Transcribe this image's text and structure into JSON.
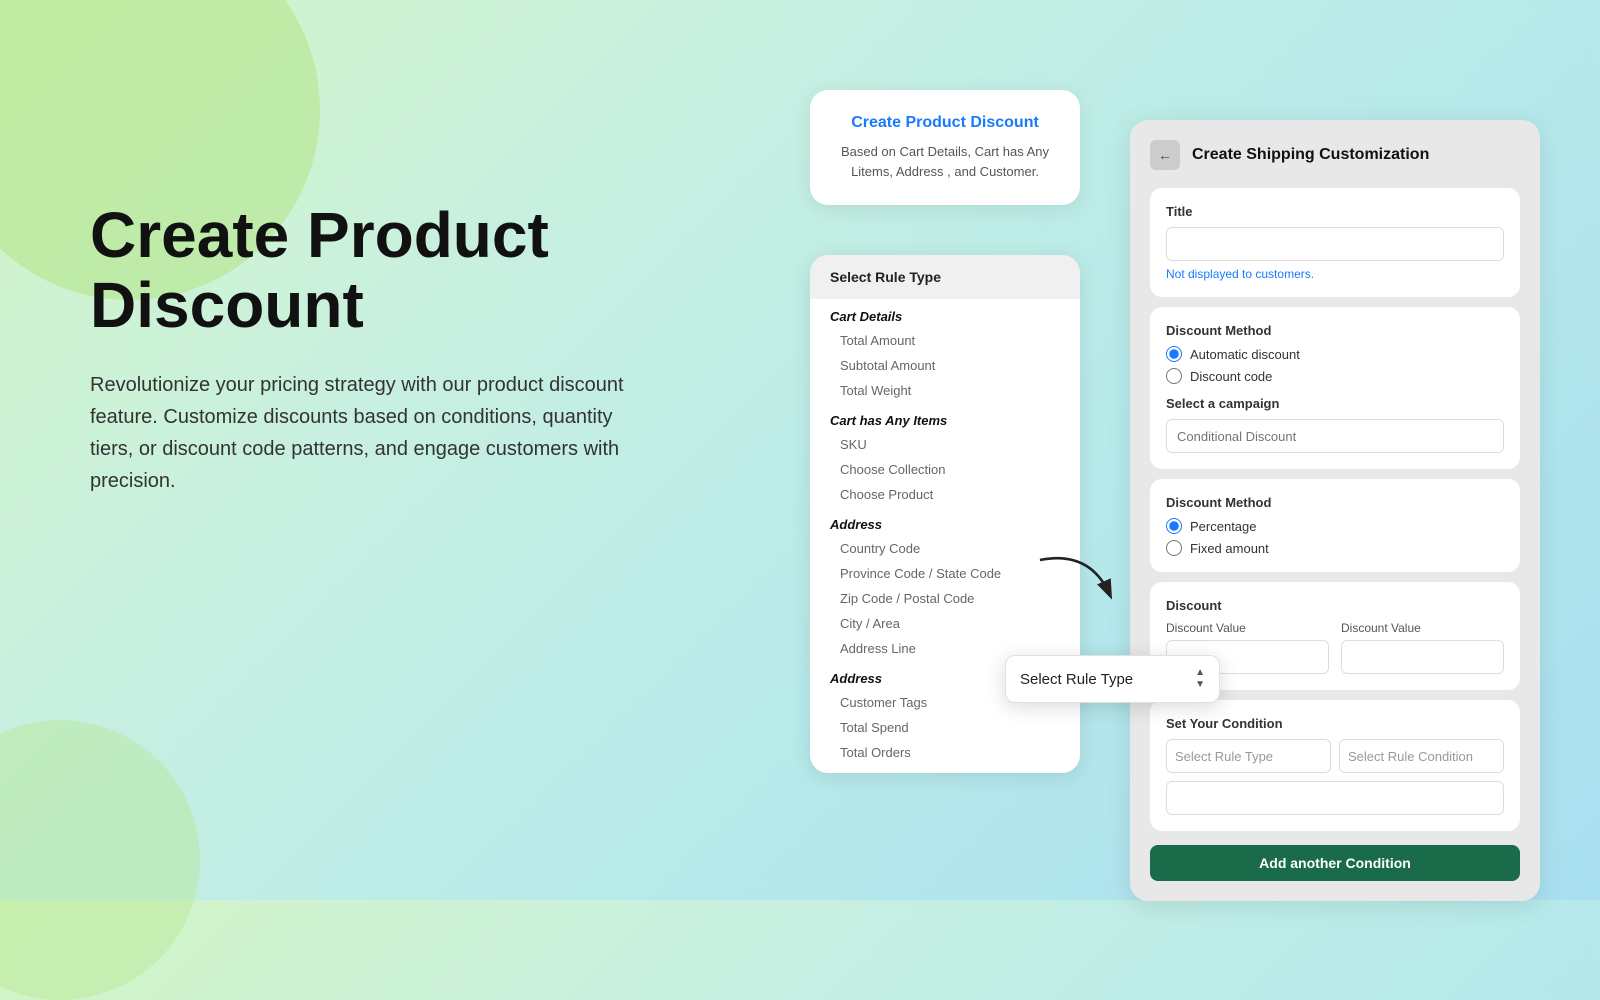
{
  "background": {
    "gradient": "linear-gradient(135deg, #d4f5c4, #b8eaea, #a8dff0)"
  },
  "left": {
    "title": "Create Product Discount",
    "description": "Revolutionize your pricing strategy with our product discount feature. Customize discounts based on conditions, quantity tiers, or discount code patterns, and engage customers with precision."
  },
  "card_info": {
    "title": "Create Product Discount",
    "description": "Based on Cart Details, Cart has Any Litems, Address , and Customer."
  },
  "card_rule": {
    "header": "Select Rule Type",
    "sections": [
      {
        "title": "Cart Details",
        "items": [
          "Total Amount",
          "Subtotal Amount",
          "Total Weight"
        ]
      },
      {
        "title": "Cart has Any Items",
        "items": [
          "SKU",
          "Choose Collection",
          "Choose Product"
        ]
      },
      {
        "title": "Address",
        "items": [
          "Country Code",
          "Province Code / State Code",
          "Zip Code / Postal Code",
          "City / Area",
          "Address Line"
        ]
      },
      {
        "title": "Address",
        "items": [
          "Customer Tags",
          "Total Spend",
          "Total Orders"
        ]
      }
    ]
  },
  "select_rule_floating": {
    "label": "Select Rule Type",
    "arrows_up": "▲",
    "arrows_down": "▼"
  },
  "card_shipping": {
    "back_icon": "←",
    "title": "Create Shipping Customization",
    "title_section": {
      "label": "Title",
      "placeholder": "",
      "note": "Not displayed to customers."
    },
    "discount_method_1": {
      "label": "Discount Method",
      "options": [
        {
          "value": "automatic",
          "label": "Automatic discount",
          "checked": true
        },
        {
          "value": "code",
          "label": "Discount code",
          "checked": false
        }
      ]
    },
    "campaign": {
      "label": "Select a campaign",
      "placeholder": "Conditional Discount"
    },
    "discount_method_2": {
      "label": "Discount Method",
      "options": [
        {
          "value": "percentage",
          "label": "Percentage",
          "checked": true
        },
        {
          "value": "fixed",
          "label": "Fixed amount",
          "checked": false
        }
      ]
    },
    "discount": {
      "label": "Discount",
      "value_label_1": "Discount Value",
      "value_label_2": "Discount Value"
    },
    "condition": {
      "label": "Set Your Condition",
      "rule_placeholder": "Select Rule Type",
      "condition_placeholder": "Select Rule Condition"
    },
    "add_condition_btn": "Add another Condition"
  }
}
